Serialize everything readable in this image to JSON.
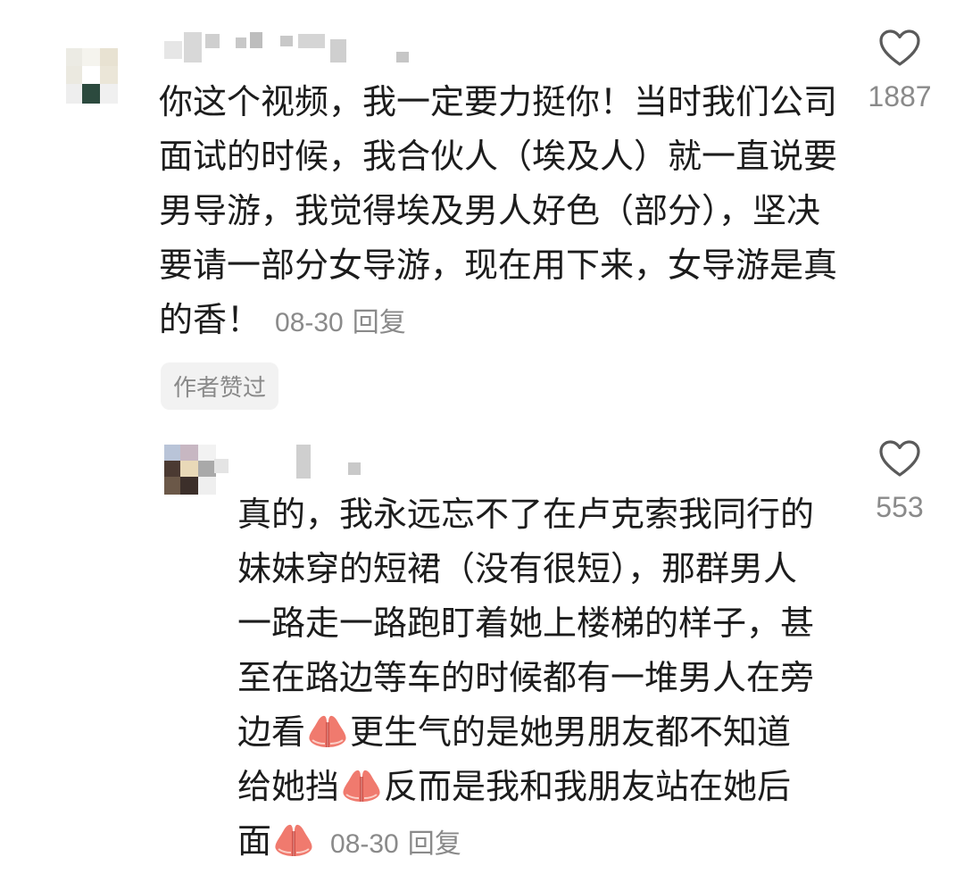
{
  "comments": [
    {
      "text": "你这个视频，我一定要力挺你！当时我们公司面试的时候，我合伙人（埃及人）就一直说要男导游，我觉得埃及男人好色（部分），坚决要请一部分女导游，现在用下来，女导游是真的香！",
      "date": "08-30",
      "reply_label": "回复",
      "like_count": "1887",
      "author_tag": "作者赞过",
      "like_icon": "heart-outline-icon"
    },
    {
      "text_parts": [
        "真的，我永远忘不了在卢克索我同行的妹妹穿的短裙（没有很短），那群男人一路走一路跑盯着她上楼梯的样子，甚至在路边等车的时候都有一堆男人在旁边看",
        "更生气的是她男朋友都不知道给她挡",
        "反而是我和我朋友站在她后面"
      ],
      "emoji": "folded-hands-emoji",
      "date": "08-30",
      "reply_label": "回复",
      "like_count": "553",
      "like_icon": "heart-outline-icon"
    }
  ],
  "colors": {
    "text": "#1c1c1c",
    "meta": "#8a8a8a",
    "tag_bg": "#f2f2f2",
    "emoji": "#f07a6e"
  }
}
